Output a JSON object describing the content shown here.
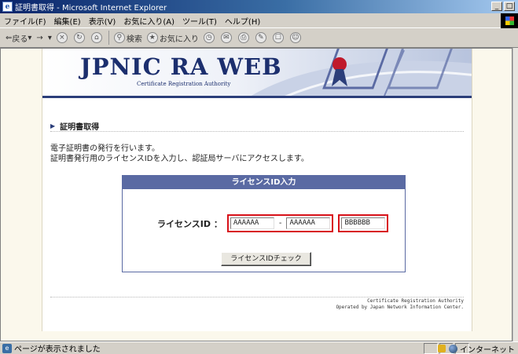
{
  "window": {
    "title": "証明書取得 - Microsoft Internet Explorer",
    "controls": [
      "_",
      "□"
    ]
  },
  "menu": [
    "ファイル(F)",
    "編集(E)",
    "表示(V)",
    "お気に入り(A)",
    "ツール(T)",
    "ヘルプ(H)"
  ],
  "toolbar": {
    "back": "戻る",
    "search": "検索",
    "favorites": "お気に入り"
  },
  "banner": {
    "logo": "JPNIC RA WEB",
    "logo_sub": "Certificate Registration Authority"
  },
  "page": {
    "heading": "証明書取得",
    "desc_line1": "電子証明書の発行を行います。",
    "desc_line2": "証明書発行用のライセンスIDを入力し、認証局サーバにアクセスします。"
  },
  "form": {
    "title": "ライセンスID入力",
    "label": "ライセンスID ：",
    "field1": "AAAAAA",
    "separator": "-",
    "field2": "AAAAAA",
    "field3": "BBBBBB",
    "check_button": "ライセンスIDチェック"
  },
  "footer": {
    "line1": "Certificate Registration Authority",
    "line2": "Operated by Japan Network Information Center."
  },
  "status": {
    "text": "ページが表示されました",
    "zone": "インターネット"
  },
  "colors": {
    "accent_blue": "#5a6aa3",
    "highlight_red": "#d8121a",
    "brand_navy": "#1c2f6e"
  }
}
